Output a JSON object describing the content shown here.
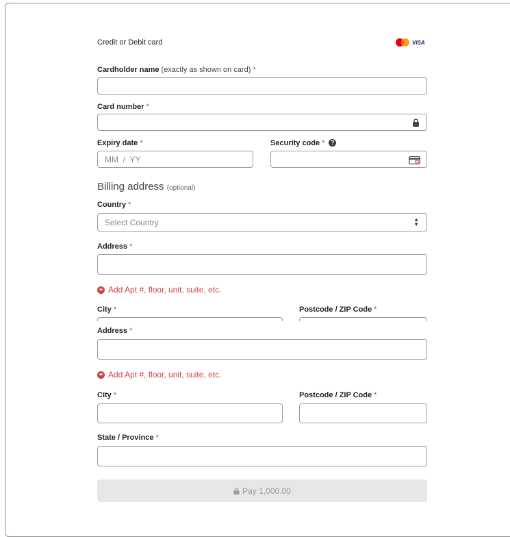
{
  "card_section": {
    "title": "Credit or Debit card",
    "brands": [
      "mastercard",
      "visa"
    ],
    "visa_label": "VISA"
  },
  "cardholder": {
    "label": "Cardholder name",
    "hint": "(exactly as shown on card)",
    "required": "*",
    "value": ""
  },
  "card_number": {
    "label": "Card number",
    "required": "*",
    "value": "",
    "icon": "lock-icon"
  },
  "expiry": {
    "label": "Expiry date",
    "required": "*",
    "placeholder": "MM  /  YY"
  },
  "security_code": {
    "label": "Security code",
    "required": "*",
    "help": "?",
    "icon": "card-cvv-icon"
  },
  "billing": {
    "title": "Billing address",
    "optional": "(optional)",
    "country": {
      "label": "Country",
      "required": "*",
      "selected": "Select Country"
    },
    "address": {
      "label": "Address",
      "required": "*"
    },
    "add_apt": "Add Apt #, floor, unit, suite, etc.",
    "city": {
      "label": "City",
      "required": "*"
    },
    "postcode": {
      "label": "Postcode / ZIP Code",
      "required": "*"
    },
    "address2": {
      "label": "Address",
      "required": "*"
    },
    "add_apt2": "Add Apt #, floor, unit, suite, etc.",
    "city2": {
      "label": "City",
      "required": "*"
    },
    "postcode2": {
      "label": "Postcode / ZIP Code",
      "required": "*"
    },
    "state": {
      "label": "State / Province",
      "required": "*"
    }
  },
  "pay_button": {
    "label": "Pay 1,000.00",
    "enabled": false
  },
  "colors": {
    "accent_red": "#c9453f",
    "border": "#9b9b9b",
    "button_disabled": "#e7e7e7"
  }
}
